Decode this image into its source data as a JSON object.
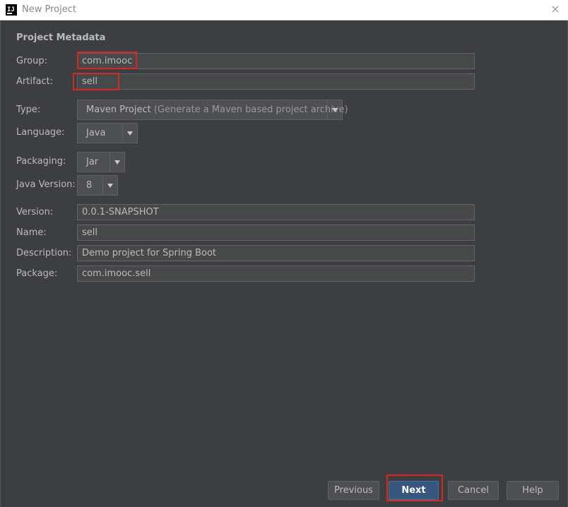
{
  "window": {
    "title": "New Project",
    "icon": "intellij-icon",
    "close": "×"
  },
  "section_title": "Project Metadata",
  "fields": {
    "group": {
      "label": "Group:",
      "value": "com.imooc"
    },
    "artifact": {
      "label": "Artifact:",
      "value": "sell"
    },
    "type": {
      "label": "Type:",
      "value": "Maven Project",
      "hint": " (Generate a Maven based project archive)"
    },
    "language": {
      "label": "Language:",
      "value": "Java"
    },
    "packaging": {
      "label": "Packaging:",
      "value": "Jar"
    },
    "java_version": {
      "label": "Java Version:",
      "value": "8"
    },
    "version": {
      "label": "Version:",
      "value": "0.0.1-SNAPSHOT"
    },
    "name": {
      "label": "Name:",
      "value": "sell"
    },
    "description": {
      "label": "Description:",
      "value": "Demo project for Spring Boot"
    },
    "package": {
      "label": "Package:",
      "value": "com.imooc.sell"
    }
  },
  "buttons": {
    "previous": "Previous",
    "next": "Next",
    "cancel": "Cancel",
    "help": "Help"
  },
  "colors": {
    "background": "#3c3f41",
    "primary_button": "#365880",
    "highlight": "#e0251b"
  }
}
